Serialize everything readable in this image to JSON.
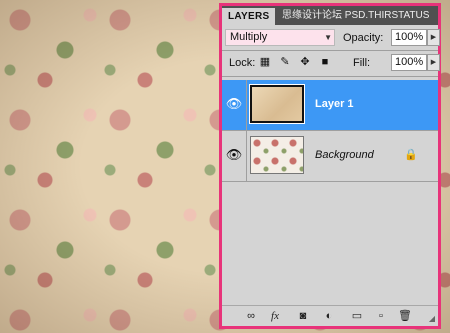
{
  "panel": {
    "tab_label": "LAYERS",
    "watermark": "思缘设计论坛 PSD.THIRSTATUS"
  },
  "controls": {
    "blend_mode": "Multiply",
    "opacity_label": "Opacity:",
    "opacity_value": "100%",
    "lock_label": "Lock:",
    "fill_label": "Fill:",
    "fill_value": "100%"
  },
  "layers": [
    {
      "name": "Layer 1",
      "visible": true,
      "selected": true,
      "thumbnail": "paper-texture"
    },
    {
      "name": "Background",
      "visible": true,
      "selected": false,
      "locked": true,
      "thumbnail": "floral-pattern"
    }
  ],
  "icons": {
    "lock_options": [
      "lock-transparent-pixels-icon",
      "lock-image-pixels-icon",
      "lock-position-icon",
      "lock-all-icon"
    ],
    "bottom_bar": [
      "link-layers-icon",
      "layer-style-fx-icon",
      "add-mask-icon",
      "adjustment-layer-icon",
      "group-folder-icon",
      "new-layer-icon",
      "delete-trash-icon"
    ]
  },
  "colors": {
    "panel_border": "#e8337a",
    "selection": "#3d98f5",
    "blend_field": "#fde2ec"
  }
}
